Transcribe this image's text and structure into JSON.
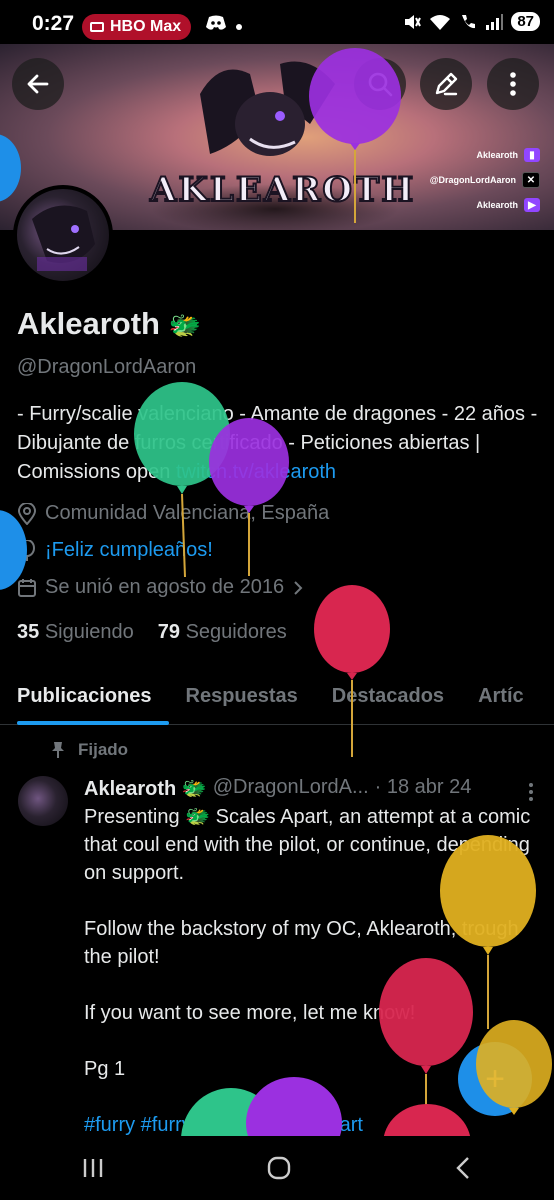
{
  "status_bar": {
    "time": "0:27",
    "app_pill": "HBO Max",
    "battery": "87"
  },
  "banner": {
    "title": "AKLEAROTH",
    "links": [
      {
        "text": "Aklearoth",
        "icon": "twitch-icon"
      },
      {
        "text": "@DragonLordAaron",
        "icon": "x-icon"
      },
      {
        "text": "Aklearoth",
        "icon": "youtube-icon"
      }
    ]
  },
  "profile": {
    "name": "Aklearoth",
    "name_emoji": "🐲",
    "handle": "@DragonLordAaron",
    "bio": "- Furry/scalie valenciano - Amante de dragones - 22 años - Dibujante de furros certificado - Peticiones abiertas | Comissions open",
    "bio_link": "twitch.tv/aklearoth",
    "location": "Comunidad Valenciana, España",
    "birthday": "¡Feliz cumpleaños!",
    "joined": "Se unió en agosto de 2016",
    "following_count": "35",
    "following_label": "Siguiendo",
    "followers_count": "79",
    "followers_label": "Seguidores"
  },
  "tabs": [
    {
      "label": "Publicaciones",
      "active": true
    },
    {
      "label": "Respuestas",
      "active": false
    },
    {
      "label": "Destacados",
      "active": false
    },
    {
      "label": "Artíc",
      "active": false
    }
  ],
  "post": {
    "pinned_label": "Fijado",
    "author_name": "Aklearoth",
    "author_emoji": "🐲",
    "author_handle": "@DragonLordA...",
    "date": "· 18 abr 24",
    "paragraph1": "Presenting 🐲 Scales Apart, an attempt at a comic that coul end with the pilot, or continue, depending on support.",
    "paragraph2": "Follow the backstory of my OC, Aklearoth, trough the pilot!",
    "paragraph3": "If you want to see more, let me know!",
    "paragraph4": "Pg 1",
    "hashtags": "#furry #furrycomic #scalesapart"
  },
  "fab_symbol": "+",
  "colors": {
    "accent": "#1d9bf0",
    "muted": "#71767b",
    "hbo": "#b0102a",
    "balloon_green": "#2ec48a",
    "balloon_purple": "#9b30e0",
    "balloon_red": "#d8264f",
    "balloon_yellow": "#e0b020",
    "balloon_blue": "#1e8fe8"
  }
}
